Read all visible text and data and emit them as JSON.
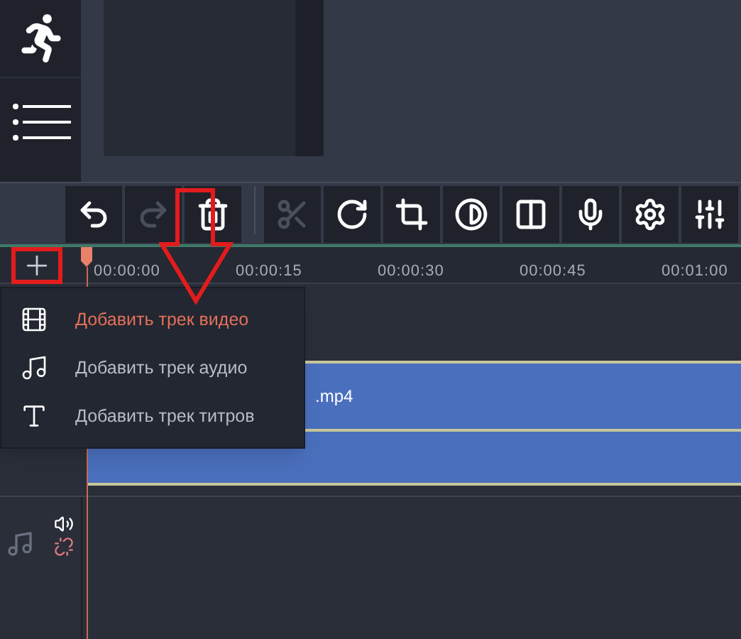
{
  "toolbar": {
    "tools": [
      {
        "kind": "undo",
        "disabled": false
      },
      {
        "kind": "redo",
        "disabled": true
      },
      {
        "kind": "delete",
        "disabled": false
      },
      {
        "kind": "cut",
        "disabled": true
      },
      {
        "kind": "rotate",
        "disabled": false
      },
      {
        "kind": "crop",
        "disabled": false
      },
      {
        "kind": "color",
        "disabled": false
      },
      {
        "kind": "split",
        "disabled": false
      },
      {
        "kind": "record",
        "disabled": false
      },
      {
        "kind": "settings",
        "disabled": false
      },
      {
        "kind": "equalizer",
        "disabled": false
      }
    ]
  },
  "ruler": {
    "timecodes": [
      "00:00:00",
      "00:00:15",
      "00:00:30",
      "00:00:45",
      "00:01:00"
    ]
  },
  "add_menu": {
    "items": [
      {
        "kind": "video",
        "label": "Добавить трек видео",
        "selected": true
      },
      {
        "kind": "audio",
        "label": "Добавить трек аудио",
        "selected": false
      },
      {
        "kind": "titles",
        "label": "Добавить трек титров",
        "selected": false
      }
    ]
  },
  "timeline": {
    "clip": {
      "name": ".mp4"
    }
  }
}
